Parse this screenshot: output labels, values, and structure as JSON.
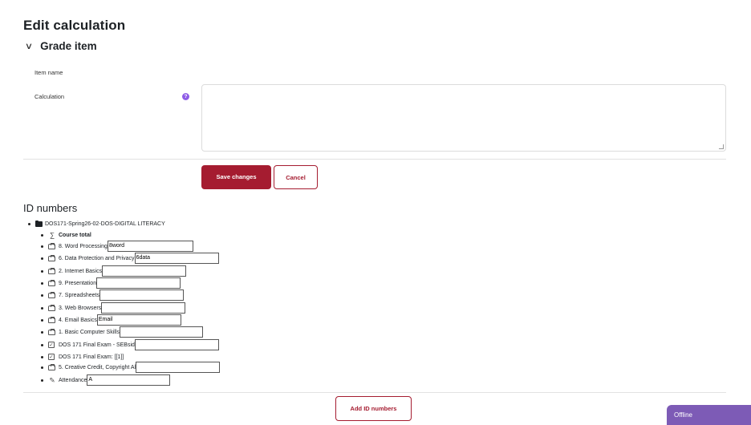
{
  "page": {
    "title": "Edit calculation"
  },
  "section": {
    "chevron": "∨",
    "title": "Grade item"
  },
  "form": {
    "item_name_label": "Item name",
    "calculation_label": "Calculation",
    "help_icon": "?",
    "calculation_value": ""
  },
  "buttons": {
    "save": "Save changes",
    "cancel": "Cancel",
    "add_ids": "Add ID numbers"
  },
  "ids": {
    "title": "ID numbers",
    "root": "DOS171-Spring26-02-DOS-DIGITAL LITERACY",
    "items": [
      {
        "icon": "sigma-icon",
        "label": "Course total",
        "bold": true,
        "input": null
      },
      {
        "icon": "grade-item-icon",
        "label": "8. Word Processing",
        "input": "8word"
      },
      {
        "icon": "grade-item-icon",
        "label": "6. Data Protection and Privacy",
        "input": "6data"
      },
      {
        "icon": "grade-item-icon",
        "label": "2. Internet Basics",
        "input": ""
      },
      {
        "icon": "grade-item-icon",
        "label": "9. Presentation",
        "input": ""
      },
      {
        "icon": "grade-item-icon",
        "label": "7. Spreadsheets",
        "input": ""
      },
      {
        "icon": "grade-item-icon",
        "label": "3. Web Browsers",
        "input": ""
      },
      {
        "icon": "grade-item-icon",
        "label": "4. Email Basics",
        "input": "Email"
      },
      {
        "icon": "grade-item-icon",
        "label": "1. Basic Computer Skills",
        "input": ""
      },
      {
        "icon": "quiz-icon",
        "label": "DOS 171 Final Exam - SEBsid",
        "input": ""
      },
      {
        "icon": "quiz-icon",
        "label": "DOS 171 Final Exam: [[1]]",
        "input": null
      },
      {
        "icon": "grade-item-icon",
        "label": "5. Creative Credit, Copyright Al",
        "input": ""
      },
      {
        "icon": "attendance-icon",
        "label": "Attendance",
        "input": "A"
      }
    ]
  },
  "status": {
    "offline": "Offline"
  },
  "colors": {
    "primary": "#a51c30",
    "help": "#8e5ce6",
    "offline_bg": "#7d5bb6"
  }
}
